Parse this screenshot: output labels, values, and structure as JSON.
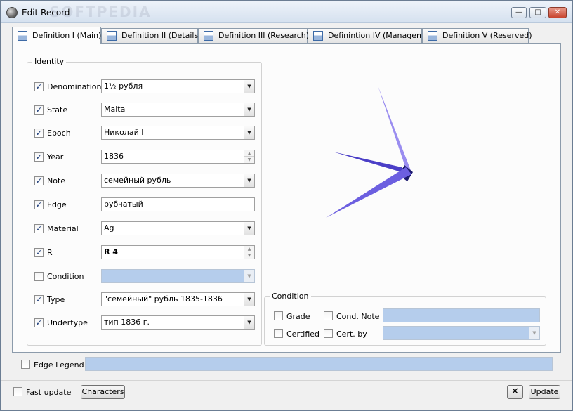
{
  "window": {
    "title": "Edit Record",
    "watermark": "SOFTPEDIA",
    "controls": {
      "minimize": "—",
      "maximize": "□",
      "close": "✕"
    }
  },
  "tabs": [
    {
      "label": "Definition I (Main)",
      "active": true
    },
    {
      "label": "Definition II (Details)",
      "active": false
    },
    {
      "label": "Definition III (Research)",
      "active": false
    },
    {
      "label": "Definintion IV (Managent)",
      "active": false
    },
    {
      "label": "Definition V (Reserved)",
      "active": false
    }
  ],
  "identity": {
    "title": "Identity",
    "rows": [
      {
        "label": "Denomination",
        "checked": true,
        "value": "1½ рубля",
        "type": "dropdown"
      },
      {
        "label": "State",
        "checked": true,
        "value": "Malta",
        "type": "dropdown"
      },
      {
        "label": "Epoch",
        "checked": true,
        "value": "Николай I",
        "type": "dropdown"
      },
      {
        "label": "Year",
        "checked": true,
        "value": "1836",
        "type": "spin"
      },
      {
        "label": "Note",
        "checked": true,
        "value": "семейный рубль",
        "type": "dropdown"
      },
      {
        "label": "Edge",
        "checked": true,
        "value": "рубчатый",
        "type": "text"
      },
      {
        "label": "Material",
        "checked": true,
        "value": "Ag",
        "type": "dropdown"
      },
      {
        "label": "R",
        "checked": true,
        "value": "R 4",
        "type": "spin"
      },
      {
        "label": "Condition",
        "checked": false,
        "value": "",
        "type": "dropdown-disabled"
      },
      {
        "label": "Type",
        "checked": true,
        "value": "\"семейный\" рубль 1835-1836",
        "type": "dropdown"
      },
      {
        "label": "Undertype",
        "checked": true,
        "value": "тип 1836 г.",
        "type": "dropdown"
      }
    ]
  },
  "image": {
    "icon": "loading-spinner-icon",
    "colors": [
      "#9a8df0",
      "#4b3fc7",
      "#1c1a6e",
      "#6c5fe0"
    ]
  },
  "condition": {
    "title": "Condition",
    "grade_label": "Grade",
    "cond_note_label": "Cond. Note",
    "certified_label": "Certified",
    "cert_by_label": "Cert. by"
  },
  "edge_legend": {
    "label": "Edge Legend",
    "value": ""
  },
  "bottom": {
    "fast_update_label": "Fast update",
    "characters_label": "Characters",
    "tools_icon": "tools-icon",
    "update_label": "Update"
  }
}
